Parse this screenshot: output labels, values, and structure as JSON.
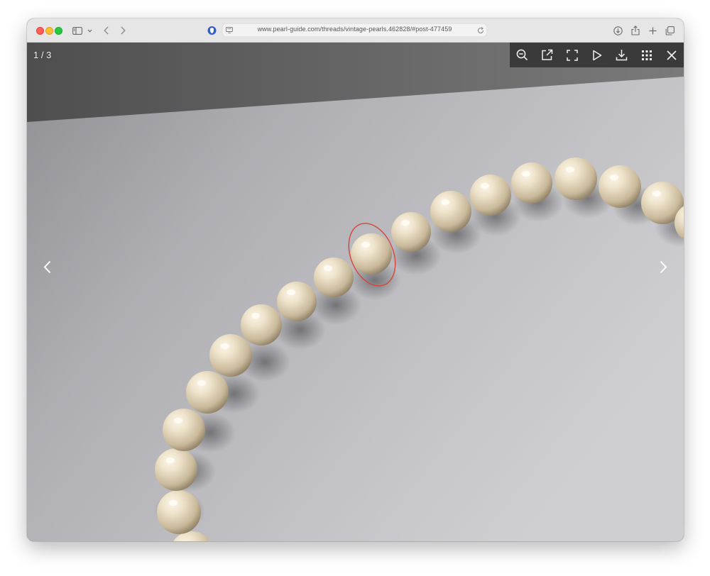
{
  "browser": {
    "url": "www.pearl-guide.com/threads/vintage-pearls.462828/#post-477459"
  },
  "lightbox": {
    "counter": "1 / 3"
  },
  "icons": {
    "sidebar": "sidebar-icon",
    "back": "chevron-left-icon",
    "forward": "chevron-right-icon",
    "privacy": "privacy-shield-icon",
    "reader": "page-icon",
    "reload": "reload-icon",
    "downloads": "download-icon",
    "share": "share-icon",
    "new_tab": "plus-icon",
    "tabs": "tabs-overview-icon",
    "zoom_out": "zoom-out-icon",
    "open_external": "external-link-icon",
    "fullscreen": "fullscreen-icon",
    "slideshow": "play-icon",
    "download": "download-icon",
    "thumbnails": "grid-icon",
    "close": "close-icon"
  },
  "colors": {
    "annotation": "#d9433a",
    "lightbox_bar": "#3a3a3a"
  }
}
